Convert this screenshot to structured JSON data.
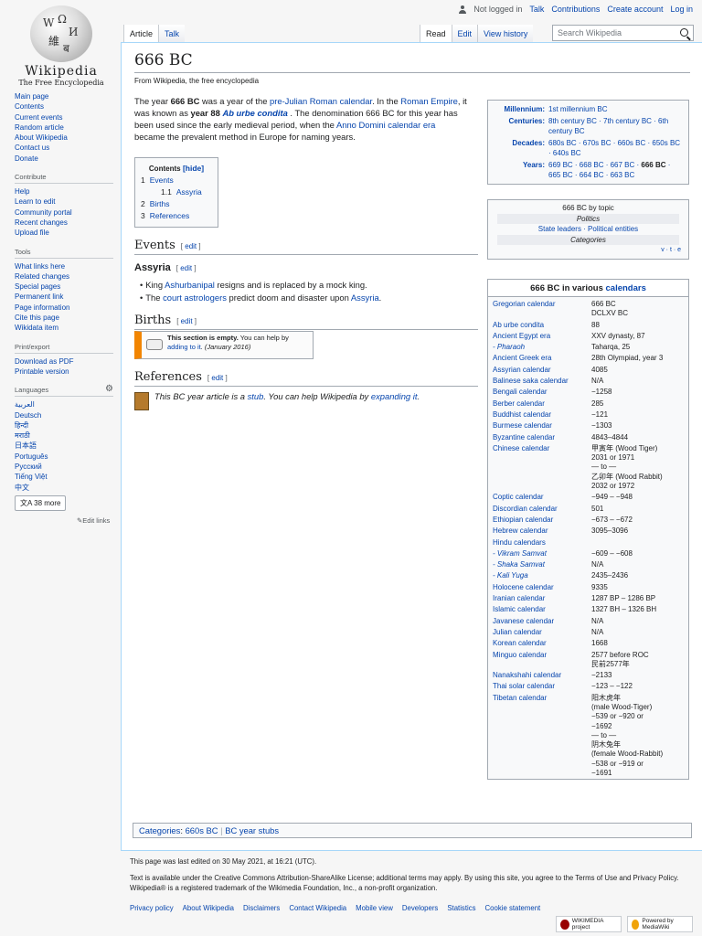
{
  "logo": {
    "wordmark": "Wikipedia",
    "tagline": "The Free Encyclopedia"
  },
  "personal": {
    "not_logged_in": "Not logged in",
    "talk": "Talk",
    "contributions": "Contributions",
    "create_account": "Create account",
    "log_in": "Log in"
  },
  "tabs": {
    "article": "Article",
    "talk": "Talk",
    "read": "Read",
    "edit": "Edit",
    "history": "View history"
  },
  "search": {
    "placeholder": "Search Wikipedia"
  },
  "sidebar": {
    "nav": [
      "Main page",
      "Contents",
      "Current events",
      "Random article",
      "About Wikipedia",
      "Contact us",
      "Donate"
    ],
    "contribute_title": "Contribute",
    "contribute": [
      "Help",
      "Learn to edit",
      "Community portal",
      "Recent changes",
      "Upload file"
    ],
    "tools_title": "Tools",
    "tools": [
      "What links here",
      "Related changes",
      "Special pages",
      "Permanent link",
      "Page information",
      "Cite this page",
      "Wikidata item"
    ],
    "print_title": "Print/export",
    "print": [
      "Download as PDF",
      "Printable version"
    ],
    "languages_title": "Languages",
    "languages": [
      "العربية",
      "Deutsch",
      "हिन्दी",
      "मराठी",
      "日本語",
      "Português",
      "Русский",
      "Tiếng Việt",
      "中文"
    ],
    "more_langs": "38 more",
    "edit_links": "Edit links"
  },
  "article": {
    "title": "666 BC",
    "from": "From Wikipedia, the free encyclopedia",
    "intro": {
      "p1": "The year ",
      "b1": "666 BC",
      "p2": " was a year of the ",
      "l1": "pre-Julian Roman calendar",
      "p3": ". In the ",
      "l2": "Roman Empire",
      "p4": ", it was known as ",
      "b2": "year 88 ",
      "l3": "Ab urbe condita",
      "p5": " . The denomination 666 BC for this year has been used since the early medieval period, when the ",
      "l4": "Anno Domini calendar era",
      "p6": " became the prevalent method in Europe for naming years."
    },
    "toc": {
      "title": "Contents",
      "hide": "[hide]",
      "items": [
        {
          "num": "1",
          "label": "Events"
        },
        {
          "num": "1.1",
          "label": "Assyria"
        },
        {
          "num": "2",
          "label": "Births"
        },
        {
          "num": "3",
          "label": "References"
        }
      ]
    },
    "events_heading": "Events",
    "assyria_heading": "Assyria",
    "edit_label": "edit",
    "assyria_items": [
      {
        "a": "King ",
        "l": "Ashurbanipal",
        "b": " resigns and is replaced by a mock king."
      },
      {
        "a": "The ",
        "l": "court astrologers",
        "b": " predict doom and disaster upon ",
        "l2": "Assyria",
        "c": "."
      }
    ],
    "births_heading": "Births",
    "empty": {
      "b": "This section is empty.",
      "t1": " You can help by ",
      "l": "adding to it",
      "t2": ". (January 2016)"
    },
    "references_heading": "References",
    "stub": {
      "t1": "This BC year article is a ",
      "l1": "stub",
      "t2": ". You can help Wikipedia by ",
      "l2": "expanding it",
      "t3": "."
    },
    "categories_label": "Categories",
    "categories": [
      "660s BC",
      "BC year stubs"
    ]
  },
  "infobox": {
    "millennium": {
      "label": "Millennium:",
      "value": "1st millennium BC"
    },
    "centuries": {
      "label": "Centuries:",
      "value": "8th century BC · 7th century BC · 6th century BC"
    },
    "decades": {
      "label": "Decades:",
      "value": "680s BC · 670s BC · 660s BC · 650s BC · 640s BC"
    },
    "years": {
      "label": "Years:",
      "v1": "669 BC · 668 BC · 667 BC ·",
      "v2": "666 BC",
      "v3": " · 665 BC · 664 BC · 663 BC"
    },
    "topic": {
      "title": "666 BC by topic",
      "politics": "Politics",
      "politics_links": "State leaders · Political entities",
      "categories": "Categories",
      "vte": "v · t · e"
    },
    "calendars_title_a": "666 BC in various ",
    "calendars_title_b": "calendars",
    "calendars": [
      {
        "name": "Gregorian calendar",
        "value": "666 BC\nDCLXV BC"
      },
      {
        "name": "Ab urbe condita",
        "value": "88"
      },
      {
        "name": "Ancient Egypt era",
        "value": "XXV dynasty, 87"
      },
      {
        "name": " - Pharaoh",
        "value": "Taharqa, 25"
      },
      {
        "name": "Ancient Greek era",
        "value": "28th Olympiad, year 3"
      },
      {
        "name": "Assyrian calendar",
        "value": "4085"
      },
      {
        "name": "Balinese saka calendar",
        "value": "N/A"
      },
      {
        "name": "Bengali calendar",
        "value": "−1258"
      },
      {
        "name": "Berber calendar",
        "value": "285"
      },
      {
        "name": "Buddhist calendar",
        "value": "−121"
      },
      {
        "name": "Burmese calendar",
        "value": "−1303"
      },
      {
        "name": "Byzantine calendar",
        "value": "4843–4844"
      },
      {
        "name": "Chinese calendar",
        "value": "甲寅年 (Wood Tiger)\n2031 or 1971\n    — to —\n乙卯年 (Wood Rabbit)\n2032 or 1972"
      },
      {
        "name": "Coptic calendar",
        "value": "−949 – −948"
      },
      {
        "name": "Discordian calendar",
        "value": "501"
      },
      {
        "name": "Ethiopian calendar",
        "value": "−673 – −672"
      },
      {
        "name": "Hebrew calendar",
        "value": "3095–3096"
      },
      {
        "name": "Hindu calendars",
        "value": ""
      },
      {
        "name": " - Vikram Samvat",
        "value": "−609 – −608"
      },
      {
        "name": " - Shaka Samvat",
        "value": "N/A"
      },
      {
        "name": " - Kali Yuga",
        "value": "2435–2436"
      },
      {
        "name": "Holocene calendar",
        "value": "9335"
      },
      {
        "name": "Iranian calendar",
        "value": "1287 BP – 1286 BP"
      },
      {
        "name": "Islamic calendar",
        "value": "1327 BH – 1326 BH"
      },
      {
        "name": "Javanese calendar",
        "value": "N/A"
      },
      {
        "name": "Julian calendar",
        "value": "N/A"
      },
      {
        "name": "Korean calendar",
        "value": "1668"
      },
      {
        "name": "Minguo calendar",
        "value": "2577 before ROC\n民前2577年"
      },
      {
        "name": "Nanakshahi calendar",
        "value": "−2133"
      },
      {
        "name": "Thai solar calendar",
        "value": "−123 – −122"
      },
      {
        "name": "Tibetan calendar",
        "value": "阳木虎年\n(male Wood-Tiger)\n−539 or −920 or\n−1692\n    — to —\n阴木兔年\n(female Wood-Rabbit)\n−538 or −919 or\n−1691"
      }
    ]
  },
  "footer": {
    "edited": "This page was last edited on 30 May 2021, at 16:21 (UTC).",
    "license": "Text is available under the Creative Commons Attribution-ShareAlike License; additional terms may apply. By using this site, you agree to the Terms of Use and Privacy Policy. Wikipedia® is a registered trademark of the Wikimedia Foundation, Inc., a non-profit organization.",
    "links": [
      "Privacy policy",
      "About Wikipedia",
      "Disclaimers",
      "Contact Wikipedia",
      "Mobile view",
      "Developers",
      "Statistics",
      "Cookie statement"
    ],
    "badge1": "WIKIMEDIA project",
    "badge2": "Powered by MediaWiki"
  }
}
